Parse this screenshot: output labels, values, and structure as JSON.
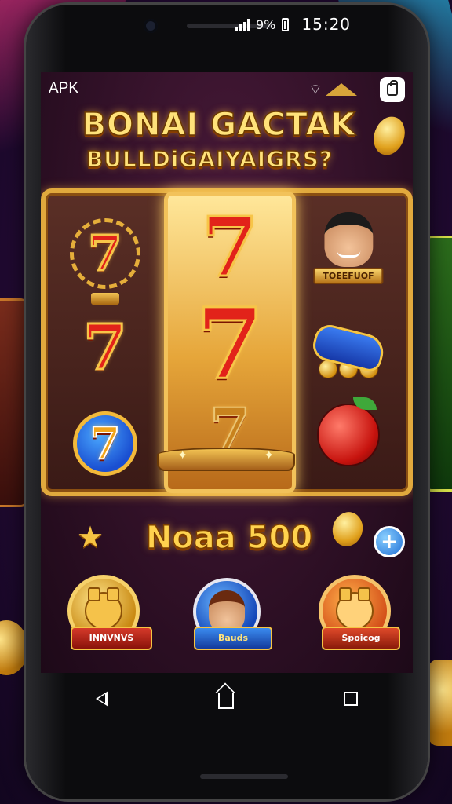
{
  "status_bar": {
    "signal_icon": "signal-bars-icon",
    "signal_text": "9%",
    "battery_icon": "battery-icon",
    "time": "15:20"
  },
  "app": {
    "apk_label": "APK",
    "title_line1": "BONAI GACTAK",
    "title_line2": "BULLDiGAIYAIGRS?"
  },
  "reels": {
    "left": [
      {
        "icon": "laurel-seven-icon",
        "symbol": "7",
        "ribbon": ""
      },
      {
        "icon": "red-seven-icon",
        "symbol": "7"
      },
      {
        "icon": "blue-seven-badge-icon",
        "symbol": "7"
      }
    ],
    "center": [
      {
        "icon": "big-seven-icon",
        "symbol": "7"
      },
      {
        "icon": "big-seven-icon",
        "symbol": "7"
      },
      {
        "icon": "faded-seven-icon",
        "symbol": "7"
      }
    ],
    "right": [
      {
        "icon": "avatar-man-icon",
        "ribbon": "TOEEFUOF"
      },
      {
        "icon": "blue-glove-coins-icon"
      },
      {
        "icon": "red-fruit-coin-icon"
      }
    ]
  },
  "balance": {
    "star_icon": "star-icon",
    "value_text": "Noaa 500",
    "coin_icon": "coin-icon",
    "add_label": "+"
  },
  "medals": [
    {
      "icon": "bear-gold-medal-icon",
      "label": "INNVNVS"
    },
    {
      "icon": "person-blue-medal-icon",
      "label": "Bauds"
    },
    {
      "icon": "bear-orange-medal-icon",
      "label": "Spoicog"
    }
  ],
  "nav": {
    "back_icon": "back-triangle-icon",
    "home_icon": "home-icon",
    "recents_icon": "recents-square-icon"
  },
  "colors": {
    "gold": "#f2c25a",
    "title_yellow": "#ffe27a",
    "seven_red": "#e2231a",
    "plus_blue": "#1e6fd6"
  }
}
